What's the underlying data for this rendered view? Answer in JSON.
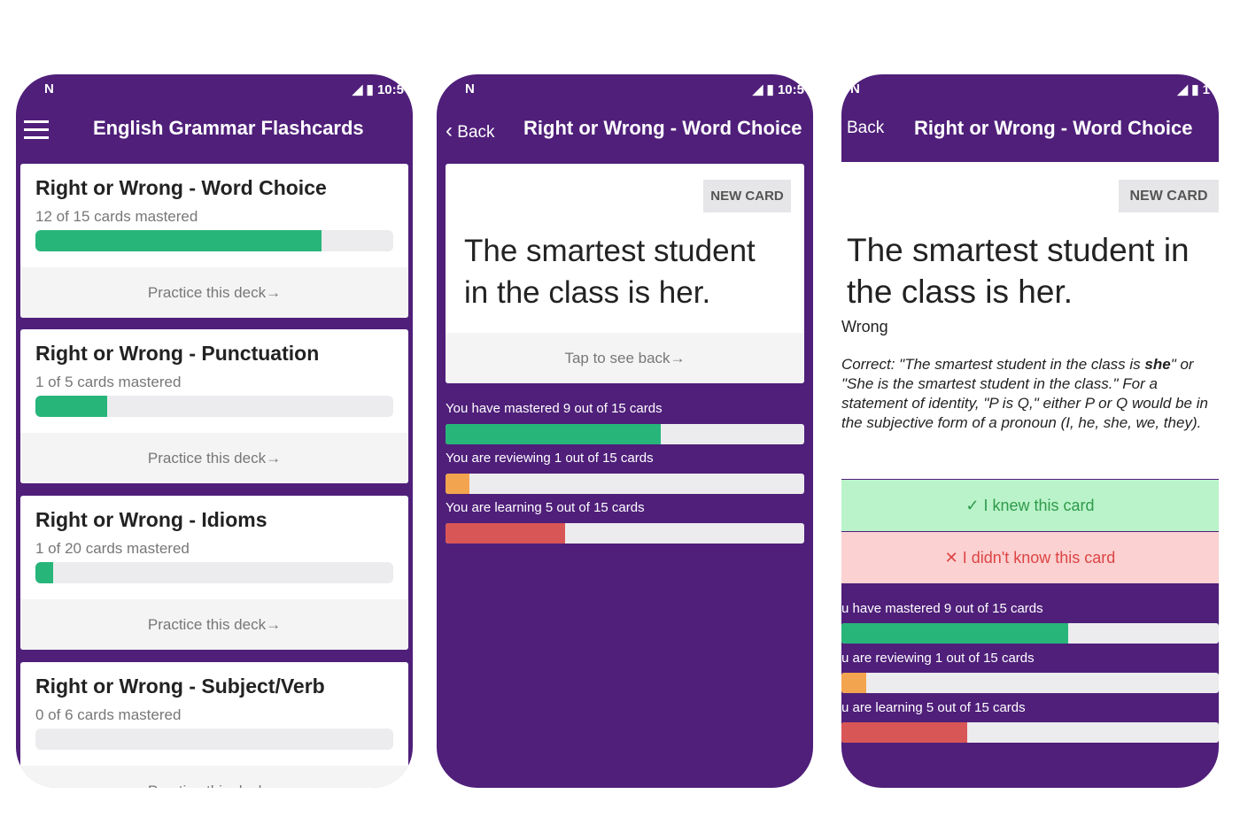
{
  "colors": {
    "primary": "#4f1f7a",
    "green": "#27b57a",
    "orange": "#f3a44f",
    "red": "#d95656",
    "knew_bg": "#baf3ca",
    "didnt_bg": "#fbd1d1"
  },
  "status": {
    "time_1": "10:5",
    "time_2": "10:5",
    "time_3": "1"
  },
  "screen1": {
    "title": "English Grammar Flashcards",
    "decks": [
      {
        "title": "Right or Wrong - Word Choice",
        "progress_text": "12 of 15 cards mastered",
        "mastered": 12,
        "total": 15,
        "action": "Practice this deck"
      },
      {
        "title": "Right or Wrong - Punctuation",
        "progress_text": "1 of 5 cards mastered",
        "mastered": 1,
        "total": 5,
        "action": "Practice this deck"
      },
      {
        "title": "Right or Wrong - Idioms",
        "progress_text": "1 of 20 cards mastered",
        "mastered": 1,
        "total": 20,
        "action": "Practice this deck"
      },
      {
        "title": "Right or Wrong - Subject/Verb",
        "progress_text": "0 of 6 cards mastered",
        "mastered": 0,
        "total": 6,
        "action": "Practice this deck"
      }
    ]
  },
  "screen2": {
    "back": "Back",
    "title": "Right or Wrong - Word Choice",
    "badge": "NEW CARD",
    "card_text": "The smartest student in the class is her.",
    "tap": "Tap to see back",
    "stats": [
      {
        "label": "You have mastered 9 out of 15 cards",
        "value": 9,
        "total": 15
      },
      {
        "label": "You are reviewing 1 out of 15 cards",
        "value": 1,
        "total": 15
      },
      {
        "label": "You are learning 5 out of 15 cards",
        "value": 5,
        "total": 15
      }
    ]
  },
  "screen3": {
    "back": "Back",
    "title": "Right or Wrong - Word Choice",
    "badge": "NEW CARD",
    "card_text": "The smartest student in the class is her.",
    "verdict": "Wrong",
    "explanation_pre": "Correct: \"The smartest student in the class is ",
    "explanation_bold": "she",
    "explanation_post": "\" or \"She is the smartest student in the class.\"  For a statement of identity, \"P is Q,\" either P or Q would be in the subjective form of a pronoun (I, he, she, we, they).",
    "knew": "I knew this card",
    "didnt": "I didn't know this card",
    "stats": [
      {
        "label": "u have mastered 9 out of 15 cards",
        "value": 9,
        "total": 15
      },
      {
        "label": "u are reviewing 1 out of 15 cards",
        "value": 1,
        "total": 15
      },
      {
        "label": "u are learning 5 out of 15 cards",
        "value": 5,
        "total": 15
      }
    ]
  }
}
